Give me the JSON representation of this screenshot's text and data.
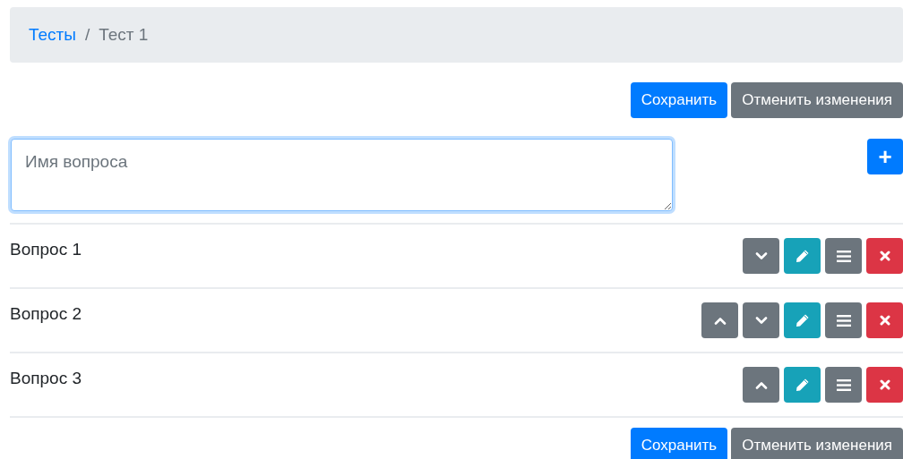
{
  "breadcrumb": [
    {
      "label": "Тесты",
      "selected": false
    },
    {
      "label": "Тест 1",
      "selected": true
    }
  ],
  "breadcrumb_separator": "/",
  "top_actions": {
    "save": "Сохранить",
    "cancel": "Отменить изменения"
  },
  "new_question": {
    "placeholder": "Имя вопроса",
    "add_button": "+"
  },
  "questions": [
    {
      "title": "Вопрос 1",
      "actions": [
        {
          "kind": "down"
        },
        {
          "kind": "edit"
        },
        {
          "kind": "menu"
        },
        {
          "kind": "delete"
        }
      ]
    },
    {
      "title": "Вопрос 2",
      "actions": [
        {
          "kind": "up"
        },
        {
          "kind": "down"
        },
        {
          "kind": "edit"
        },
        {
          "kind": "menu"
        },
        {
          "kind": "delete"
        }
      ]
    },
    {
      "title": "Вопрос 3",
      "actions": [
        {
          "kind": "up"
        },
        {
          "kind": "edit"
        },
        {
          "kind": "menu"
        },
        {
          "kind": "delete"
        }
      ]
    }
  ],
  "bottom_actions": {
    "save": "Сохранить",
    "cancel": "Отменить изменения"
  }
}
